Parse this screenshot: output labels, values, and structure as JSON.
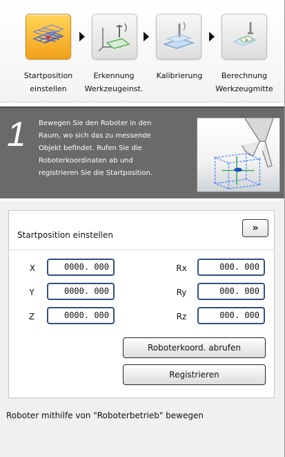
{
  "steps": [
    {
      "label_line1": "Startposition",
      "label_line2": "einstellen",
      "icon": "grid-plane-icon",
      "active": true
    },
    {
      "label_line1": "Erkennung",
      "label_line2": "Werkzeugeinst.",
      "icon": "axes-detection-icon",
      "active": false
    },
    {
      "label_line1": "Kalibrierung",
      "label_line2": "",
      "icon": "calibration-icon",
      "active": false
    },
    {
      "label_line1": "Berechnung",
      "label_line2": "Werkzeugmitte",
      "icon": "tool-center-icon",
      "active": false
    }
  ],
  "instruction": {
    "number": "1",
    "text_lines": [
      "Bewegen Sie den Roboter in den",
      "Raum, wo sich das zu messende",
      "Objekt befindet. Rufen Sie die",
      "Roboterkoordinaten ab und",
      "registrieren Sie die Startposition."
    ],
    "image_icon": "robot-gripper-cube-icon"
  },
  "panel": {
    "title": "Startposition einstellen",
    "expand_label": "»",
    "coords": {
      "x": {
        "label": "X",
        "value": "0000. 000"
      },
      "y": {
        "label": "Y",
        "value": "0000. 000"
      },
      "z": {
        "label": "Z",
        "value": "0000. 000"
      },
      "rx": {
        "label": "Rx",
        "value": "000. 000"
      },
      "ry": {
        "label": "Ry",
        "value": "000. 000"
      },
      "rz": {
        "label": "Rz",
        "value": "000. 000"
      }
    },
    "get_coords_label": "Roboterkoord. abrufen",
    "register_label": "Registrieren"
  },
  "hint": "Roboter mithilfe von \"Roboterbetrieb\" bewegen",
  "colors": {
    "active_step": "#f2a11a",
    "field_border": "#2f4f7f",
    "instruction_bg": "#6a6a6a"
  }
}
